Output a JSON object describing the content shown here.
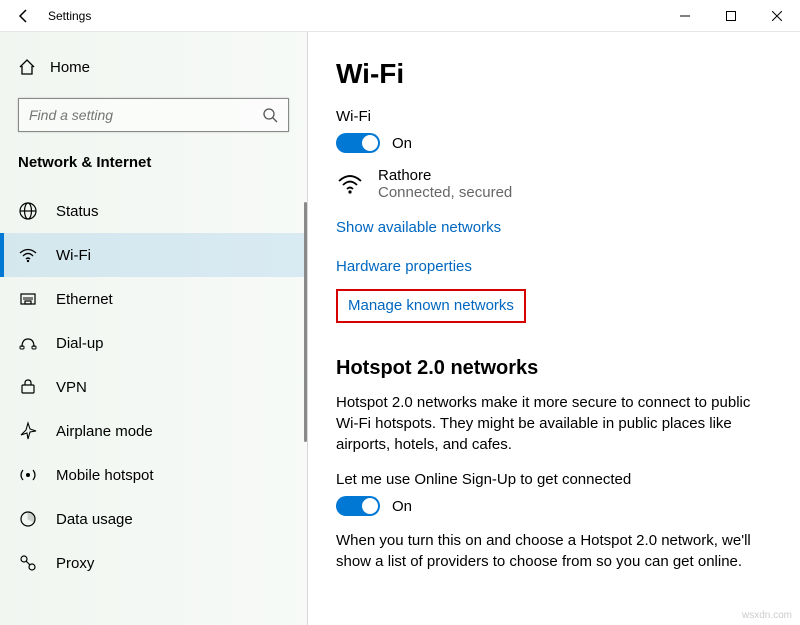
{
  "titlebar": {
    "title": "Settings"
  },
  "sidebar": {
    "home": "Home",
    "search_placeholder": "Find a setting",
    "category": "Network & Internet",
    "items": [
      {
        "label": "Status"
      },
      {
        "label": "Wi-Fi"
      },
      {
        "label": "Ethernet"
      },
      {
        "label": "Dial-up"
      },
      {
        "label": "VPN"
      },
      {
        "label": "Airplane mode"
      },
      {
        "label": "Mobile hotspot"
      },
      {
        "label": "Data usage"
      },
      {
        "label": "Proxy"
      }
    ]
  },
  "main": {
    "heading": "Wi-Fi",
    "wifi_label": "Wi-Fi",
    "wifi_toggle_state": "On",
    "connected": {
      "name": "Rathore",
      "status": "Connected, secured"
    },
    "links": {
      "show_available": "Show available networks",
      "hardware_props": "Hardware properties",
      "manage_known": "Manage known networks"
    },
    "hotspot": {
      "heading": "Hotspot 2.0 networks",
      "desc": "Hotspot 2.0 networks make it more secure to connect to public Wi-Fi hotspots. They might be available in public places like airports, hotels, and cafes.",
      "signup_label": "Let me use Online Sign-Up to get connected",
      "signup_state": "On",
      "signup_desc": "When you turn this on and choose a Hotspot 2.0 network, we'll show a list of providers to choose from so you can get online."
    }
  },
  "watermark": "wsxdn.com"
}
